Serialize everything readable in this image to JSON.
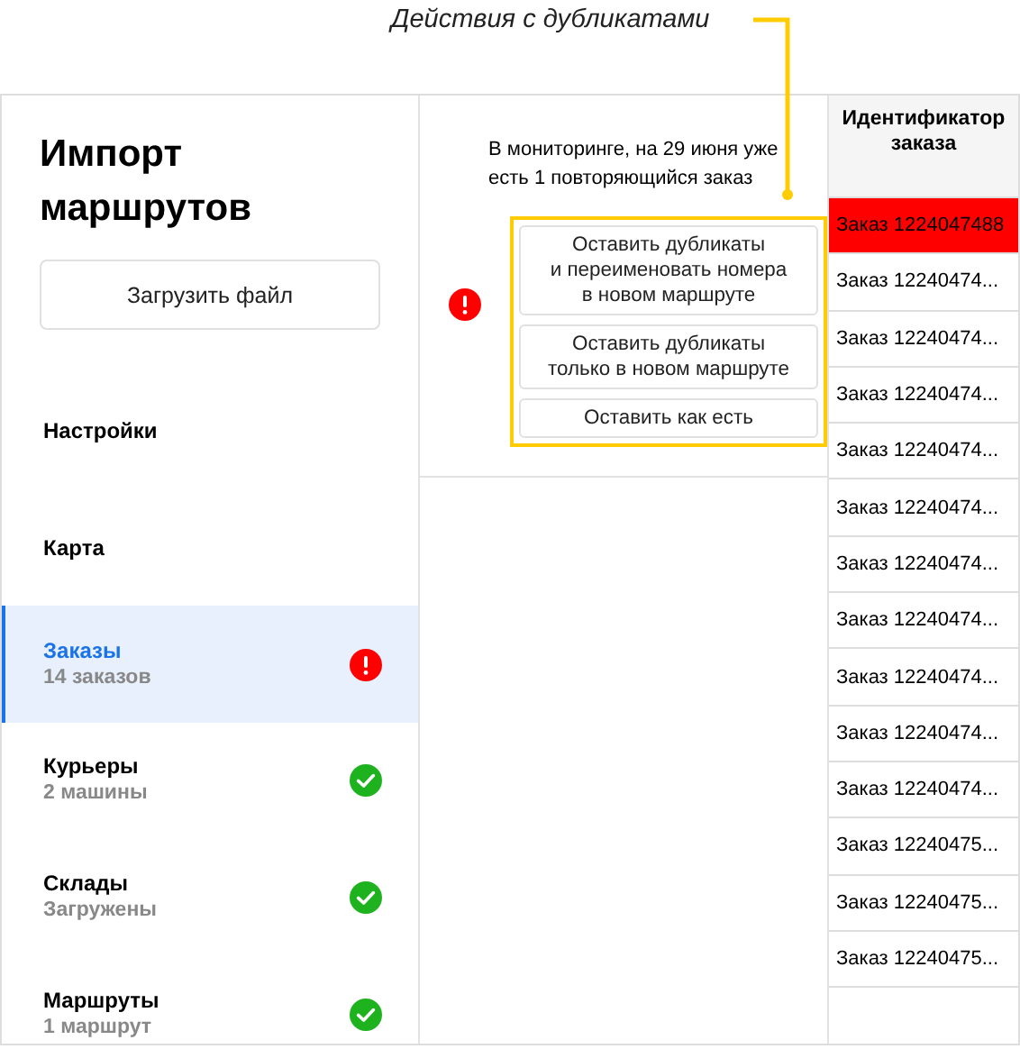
{
  "annotation": {
    "text": "Действия с дубликатами"
  },
  "sidebar": {
    "title": "Импорт маршрутов",
    "upload_button": "Загрузить файл",
    "items": [
      {
        "label": "Настройки",
        "selected": false,
        "error": false,
        "done": false
      },
      {
        "label": "Карта",
        "selected": false,
        "error": false,
        "done": false
      },
      {
        "label": "Заказы",
        "sublabel": "14 заказов",
        "selected": true,
        "error": true,
        "done": false
      },
      {
        "label": "Курьеры",
        "sublabel": "2 машины",
        "selected": false,
        "error": false,
        "done": true
      },
      {
        "label": "Склады",
        "sublabel": "Загружены",
        "selected": false,
        "error": false,
        "done": true
      },
      {
        "label": "Маршруты",
        "sublabel": "1 маршрут",
        "selected": false,
        "error": false,
        "done": true
      }
    ]
  },
  "duplicates": {
    "message": "В мониторинге, на 29 июня уже есть 1 повторяющийся заказ",
    "error": true,
    "actions": [
      "Оставить дубликаты\nи переименовать номера\nв новом маршруте",
      "Оставить дубликаты\nтолько в новом маршруте",
      "Оставить как есть"
    ]
  },
  "table": {
    "columns": [
      "Идентификатор заказа"
    ],
    "rows": [
      {
        "cells": [
          "Заказ 1224047488"
        ],
        "duplicate": true
      },
      {
        "cells": [
          "Заказ 12240474..."
        ],
        "duplicate": false
      },
      {
        "cells": [
          "Заказ 12240474..."
        ],
        "duplicate": false
      },
      {
        "cells": [
          "Заказ 12240474..."
        ],
        "duplicate": false
      },
      {
        "cells": [
          "Заказ 12240474..."
        ],
        "duplicate": false
      },
      {
        "cells": [
          "Заказ 12240474..."
        ],
        "duplicate": false
      },
      {
        "cells": [
          "Заказ 12240474..."
        ],
        "duplicate": false
      },
      {
        "cells": [
          "Заказ 12240474..."
        ],
        "duplicate": false
      },
      {
        "cells": [
          "Заказ 12240474..."
        ],
        "duplicate": false
      },
      {
        "cells": [
          "Заказ 12240474..."
        ],
        "duplicate": false
      },
      {
        "cells": [
          "Заказ 12240474..."
        ],
        "duplicate": false
      },
      {
        "cells": [
          "Заказ 12240475..."
        ],
        "duplicate": false
      },
      {
        "cells": [
          "Заказ 12240475..."
        ],
        "duplicate": false
      },
      {
        "cells": [
          "Заказ 12240475..."
        ],
        "duplicate": false
      }
    ]
  }
}
